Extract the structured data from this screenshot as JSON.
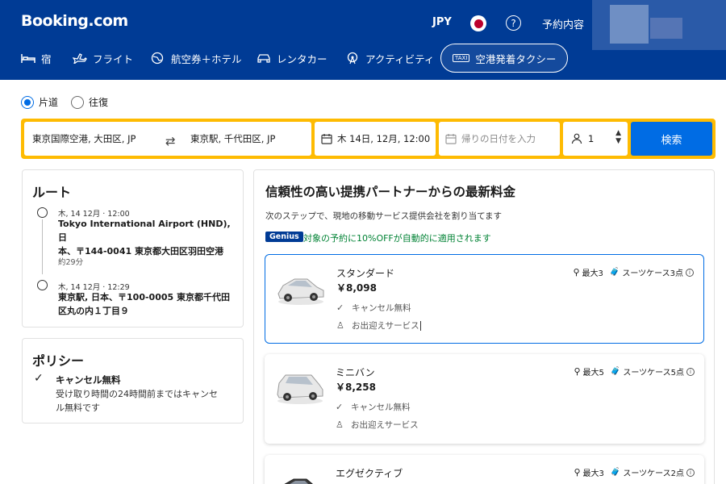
{
  "header": {
    "logo": "Booking.com",
    "currency": "JPY",
    "help_icon": "?",
    "bookings": "予約内容"
  },
  "nav": {
    "stays": "宿",
    "flights": "フライト",
    "flight_hotel": "航空券＋ホテル",
    "car_rental": "レンタカー",
    "activities": "アクティビティ",
    "airport_taxi": "空港発着タクシー",
    "taxi_icon_text": "TAXI"
  },
  "trip": {
    "one_way": "片道",
    "round_trip": "往復"
  },
  "search": {
    "from": "東京国際空港, 大田区, JP",
    "to": "東京駅, 千代田区, JP",
    "date": "木 14日, 12月, 12:00",
    "return_placeholder": "帰りの日付を入力",
    "passengers": "1",
    "button": "検索"
  },
  "route": {
    "title": "ルート",
    "pickup_time": "木, 14 12月 · 12:00",
    "pickup_place": "Tokyo International Airport (HND), 日本、〒144-0041 東京都大田区羽田空港",
    "pickup_place_l1": "Tokyo International Airport (HND), 日",
    "pickup_place_l2": "本、〒144-0041 東京都大田区羽田空港",
    "duration": "約29分",
    "dropoff_time": "木, 14 12月 · 12:29",
    "dropoff_place": "東京駅, 日本、〒100-0005 東京都千代田区丸の内１丁目９",
    "dropoff_place_l1": "東京駅, 日本、〒100-0005 東京都千代田",
    "dropoff_place_l2": "区丸の内１丁目９"
  },
  "policy": {
    "title": "ポリシー",
    "item_title": "キャンセル無料",
    "item_desc_l1": "受け取り時間の24時間前まではキャンセ",
    "item_desc_l2": "ル無料です"
  },
  "results": {
    "heading": "信頼性の高い提携パートナーからの最新料金",
    "subheading": "次のステップで、現地の移動サービス提供会社を割り当てます",
    "genius_badge": "Genius",
    "genius_text": "対象の予約に10%OFFが自動的に適用されます",
    "options": [
      {
        "name": "スタンダード",
        "price": "￥8,098",
        "feature_1": "キャンセル無料",
        "feature_2": "お出迎えサービス",
        "passengers": "最大3",
        "luggage": "スーツケース3点"
      },
      {
        "name": "ミニバン",
        "price": "￥8,258",
        "feature_1": "キャンセル無料",
        "feature_2": "お出迎えサービス",
        "passengers": "最大5",
        "luggage": "スーツケース5点"
      },
      {
        "name": "エグゼクティブ",
        "price": "",
        "passengers": "最大3",
        "luggage": "スーツケース2点"
      }
    ]
  },
  "colors": {
    "brand_blue": "#003b95",
    "search_yellow": "#febb02",
    "action_blue": "#006ce4",
    "genius_green": "#008234"
  }
}
